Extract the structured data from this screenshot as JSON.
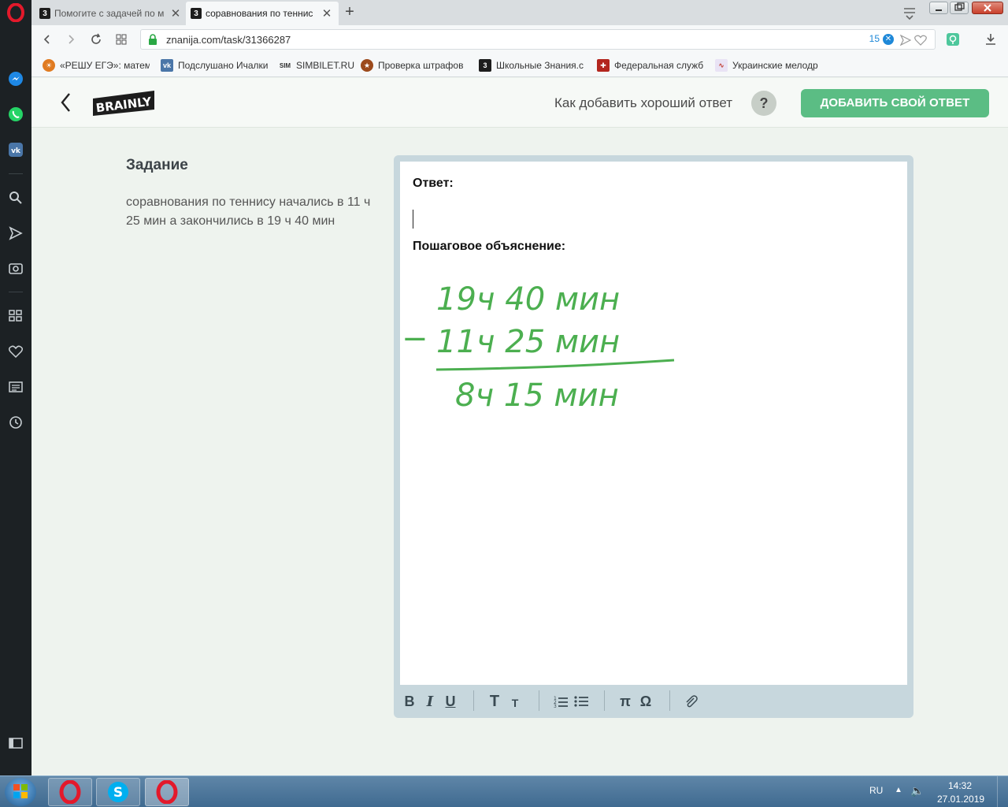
{
  "browser": {
    "tabs": [
      {
        "favicon": "3",
        "title": "Помогите с задачей по м"
      },
      {
        "favicon": "3",
        "title": "сорaвнования по теннис"
      }
    ],
    "close_glyph": "✕",
    "new_tab_glyph": "+",
    "url": "znanija.com/task/31366287",
    "url_counter": "15",
    "bookmarks": [
      {
        "icon": "reshu-ege-icon",
        "label": "«РЕШУ ЕГЭ»: матема",
        "color": "#e07b21"
      },
      {
        "icon": "vk-icon",
        "label": "Подслушано Ичалки",
        "color": "#4a76a8"
      },
      {
        "icon": "sim-icon",
        "label": "SIMBILET.RU",
        "color": "#555555"
      },
      {
        "icon": "gibdd-icon",
        "label": "Проверка штрафов",
        "color": "#9c4a1c"
      },
      {
        "icon": "znanija-icon",
        "label": "Школьные Знания.с",
        "color": "#1d1d1d"
      },
      {
        "icon": "fed-service-icon",
        "label": "Федеральная служб",
        "color": "#b3261e"
      },
      {
        "icon": "ukr-melody-icon",
        "label": "Украинские мелодр",
        "color": "#c0392b"
      }
    ]
  },
  "header": {
    "logo_text": "BRAINLY",
    "how_to_link": "Как добавить хороший ответ",
    "help_glyph": "?",
    "add_answer_button": "ДОБАВИТЬ СВОЙ ОТВЕТ"
  },
  "task": {
    "heading": "Задание",
    "text": "сорaвнования по теннису начались в 11 ч 25 мин а закончились в 19 ч 40 мин"
  },
  "editor": {
    "answer_label": "Ответ:",
    "explanation_label": "Пошаговое объяснение:",
    "handwriting": {
      "line1": "19ч 40 мин",
      "minus": "−",
      "line2": "11ч 25 мин",
      "result": "8ч 15 мин",
      "ink_color": "#4caf50"
    },
    "toolbar": {
      "bold": "B",
      "italic": "I",
      "underline": "U",
      "heading_large": "T",
      "heading_small": "T",
      "pi": "π",
      "omega": "Ω"
    }
  },
  "taskbar": {
    "language": "RU",
    "time": "14:32",
    "date": "27.01.2019"
  },
  "colors": {
    "accent_green": "#5bbd84",
    "sidebar_bg": "#1c2124",
    "page_bg": "#eef3ee"
  }
}
